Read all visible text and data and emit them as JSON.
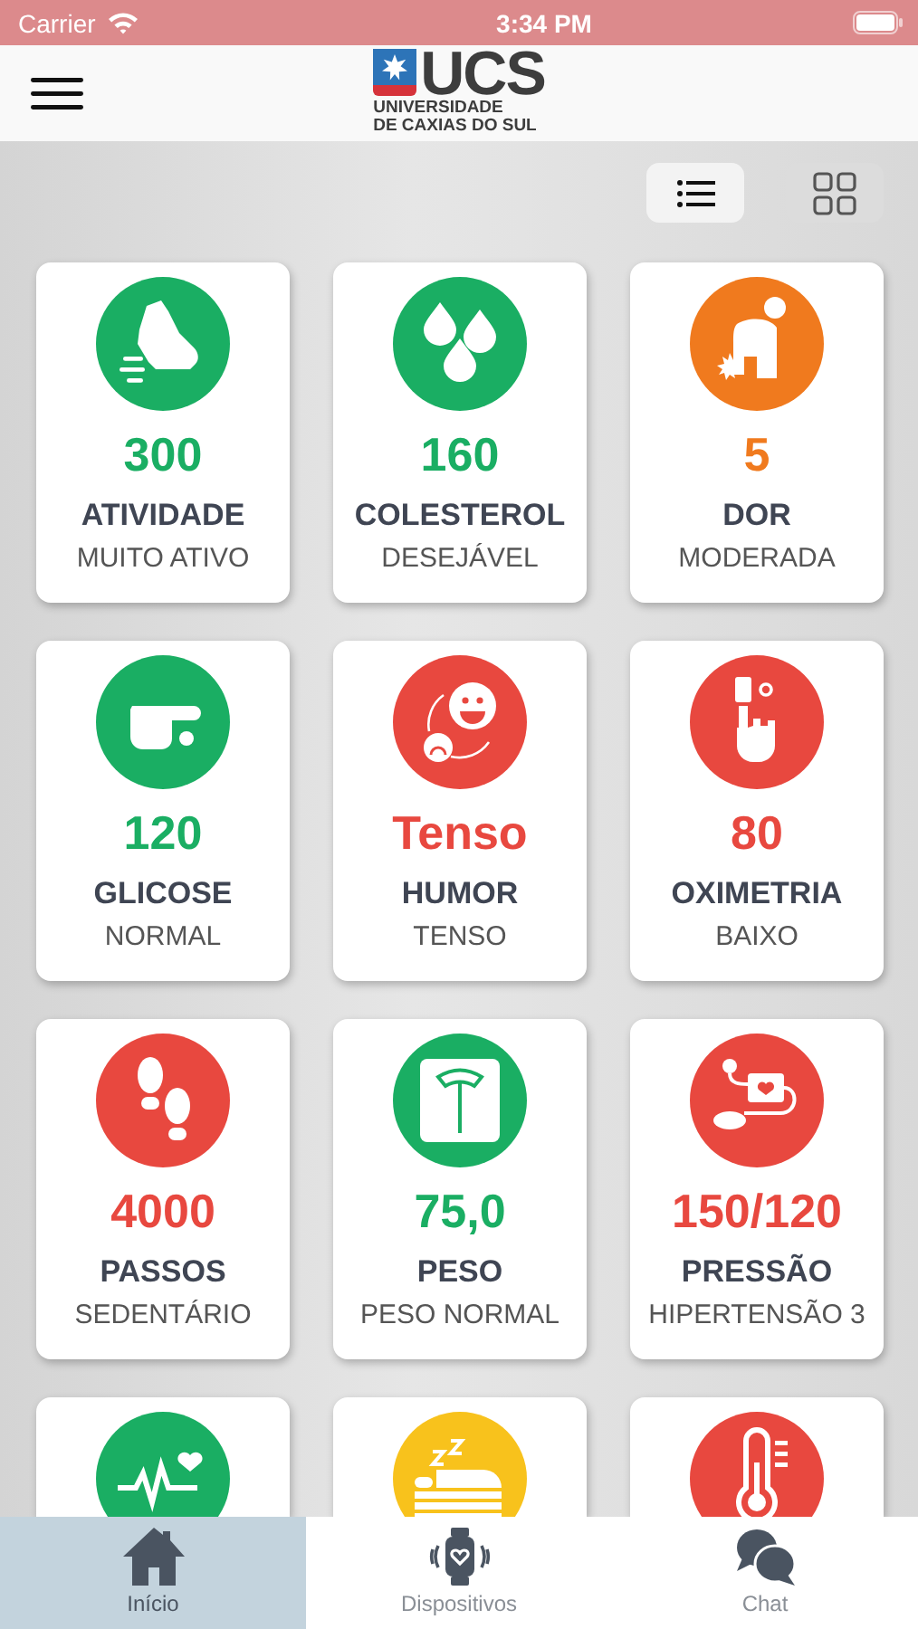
{
  "status_bar": {
    "carrier": "Carrier",
    "time": "3:34 PM"
  },
  "header": {
    "logo": {
      "short": "UCS",
      "line1": "UNIVERSIDADE",
      "line2": "DE CAXIAS DO SUL"
    }
  },
  "view_toggle": [
    {
      "kind": "list",
      "selected": true
    },
    {
      "kind": "grid",
      "selected": false
    }
  ],
  "cards": [
    {
      "kind": "shoe",
      "color": "#1aae63",
      "value": "300",
      "name": "ATIVIDADE",
      "status": "MUITO ATIVO"
    },
    {
      "kind": "drops",
      "color": "#1aae63",
      "value": "160",
      "name": "COLESTEROL",
      "status": "DESEJÁVEL"
    },
    {
      "kind": "pain",
      "color": "#f07a1e",
      "value": "5",
      "name": "DOR",
      "status": "MODERADA"
    },
    {
      "kind": "finger",
      "color": "#1aae63",
      "value": "120",
      "name": "GLICOSE",
      "status": "NORMAL"
    },
    {
      "kind": "mood",
      "color": "#e8483f",
      "value": "Tenso",
      "name": "HUMOR",
      "status": "TENSO"
    },
    {
      "kind": "oximeter",
      "color": "#e8483f",
      "value": "80",
      "name": "OXIMETRIA",
      "status": "BAIXO"
    },
    {
      "kind": "steps",
      "color": "#e8483f",
      "value": "4000",
      "name": "PASSOS",
      "status": "SEDENTÁRIO"
    },
    {
      "kind": "scale",
      "color": "#1aae63",
      "value": "75,0",
      "name": "PESO",
      "status": "PESO NORMAL"
    },
    {
      "kind": "pressure",
      "color": "#e8483f",
      "value": "150/120",
      "name": "PRESSÃO",
      "status": "HIPERTENSÃO 3"
    },
    {
      "kind": "heartbeat",
      "color": "#1aae63"
    },
    {
      "kind": "sleep",
      "color": "#f8c21c"
    },
    {
      "kind": "thermometer",
      "color": "#e8483f"
    }
  ],
  "tab_bar": [
    {
      "kind": "home",
      "label": "Início",
      "selected": true
    },
    {
      "kind": "watch",
      "label": "Dispositivos",
      "selected": false
    },
    {
      "kind": "chat",
      "label": "Chat",
      "selected": false
    }
  ]
}
